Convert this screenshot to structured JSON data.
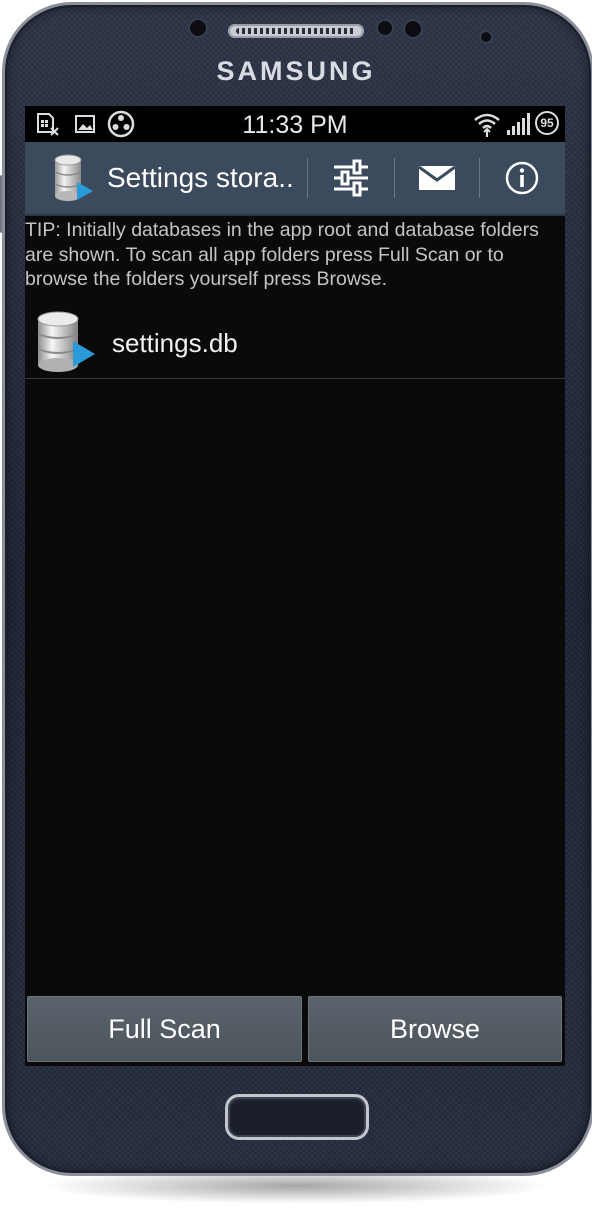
{
  "device": {
    "brand": "SAMSUNG"
  },
  "status_bar": {
    "time": "11:33 PM",
    "battery_level": "95",
    "icons": [
      "sim-error-icon",
      "image-icon",
      "film-reel-icon",
      "wifi-icon",
      "signal-icon",
      "battery-icon"
    ]
  },
  "action_bar": {
    "title": "Settings stora..",
    "actions": [
      "settings-sliders-icon",
      "mail-icon",
      "info-icon"
    ]
  },
  "tip": "TIP: Initially databases in the app root and database folders are shown. To scan all app folders press Full Scan or to browse the folders yourself press Browse.",
  "databases": [
    {
      "name": "settings.db"
    }
  ],
  "buttons": {
    "full_scan": "Full Scan",
    "browse": "Browse"
  },
  "colors": {
    "action_bar": "#3b4a5c",
    "screen_background": "#0a0a0a",
    "button": "#525a62",
    "play_accent": "#2a9ad8"
  }
}
